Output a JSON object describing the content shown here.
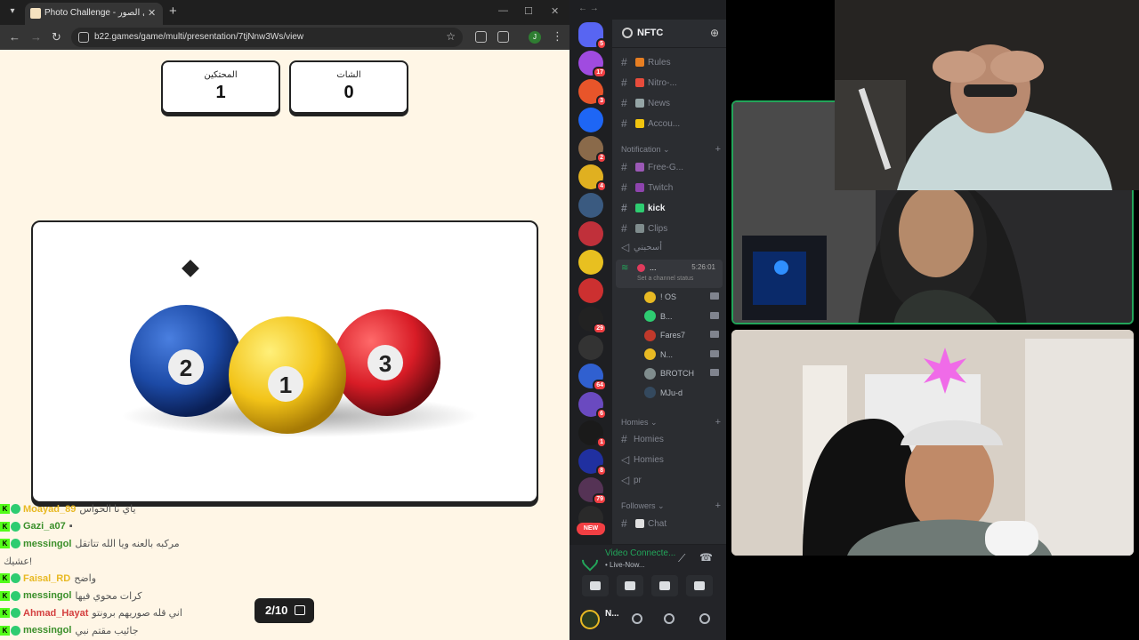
{
  "browser": {
    "tab_title": "Photo Challenge - تحدي الصور",
    "tab_close": "✕",
    "new_tab": "+",
    "url": "b22.games/game/multi/presentation/7tjNnw3Ws/view",
    "profile_initial": "J"
  },
  "scores": [
    {
      "label": "المحتكين",
      "value": "1"
    },
    {
      "label": "الشات",
      "value": "0"
    }
  ],
  "image": {
    "description": "billiard balls",
    "balls": [
      {
        "number": "2",
        "color": "#1c4aa6"
      },
      {
        "number": "1",
        "color": "#f2c318"
      },
      {
        "number": "3",
        "color": "#d81c26"
      }
    ]
  },
  "chat": [
    {
      "user": "Moayad_89",
      "color": "#e8b923",
      "message": "ياي نا الحواس"
    },
    {
      "user": "Gazi_a07",
      "color": "#3a8f2a",
      "message": "▪"
    },
    {
      "user": "messingol",
      "color": "#3a8f2a",
      "message": "مركبه بالعنه ويا الله تتاتقل"
    },
    {
      "user": "",
      "color": "#555555",
      "message": "عشيك!"
    },
    {
      "user": "Faisal_RD",
      "color": "#e8b923",
      "message": "واضح"
    },
    {
      "user": "messingol",
      "color": "#3a8f2a",
      "message": "كرات محوي فيها"
    },
    {
      "user": "Ahmad_Hayat",
      "color": "#d43f3f",
      "message": "اني قله صوريهم برونتو"
    },
    {
      "user": "messingol",
      "color": "#3a8f2a",
      "message": "جائيب مقتم نبي"
    }
  ],
  "slide_counter": "2/10",
  "discord": {
    "server_name": "NFTC",
    "channels": [
      {
        "name": "Rules",
        "icon_color": "#e67e22"
      },
      {
        "name": "Nitro-...",
        "icon_color": "#e74c3c"
      },
      {
        "name": "News",
        "icon_color": "#95a5a6"
      },
      {
        "name": "Accou...",
        "icon_color": "#f1c40f"
      }
    ],
    "category_notification": "Notification",
    "notif_channels": [
      {
        "name": "Free-G...",
        "icon_color": "#9b59b6",
        "bold": false
      },
      {
        "name": "Twitch",
        "icon_color": "#8e44ad",
        "bold": false
      },
      {
        "name": "kick",
        "icon_color": "#2ecc71",
        "bold": true
      },
      {
        "name": "Clips",
        "icon_color": "#7f8c8d",
        "bold": false
      }
    ],
    "voice_label": "أسحبني",
    "active_voice": {
      "name": "...",
      "time": "5:26:01",
      "status": "Set a channel status"
    },
    "voice_users": [
      {
        "name": "! OS",
        "color": "#e8b923"
      },
      {
        "name": "B...",
        "color": "#2ecc71"
      },
      {
        "name": "Fares7",
        "color": "#c0392b"
      },
      {
        "name": "N...",
        "color": "#e8b923"
      },
      {
        "name": "BROTCH",
        "color": "#7f8c8d"
      },
      {
        "name": "MJu-d",
        "color": "#34495e"
      }
    ],
    "category_homies": "Homies",
    "homies_channels": [
      "Homies",
      "Homies",
      "pr"
    ],
    "category_followers": "Followers",
    "followers_channel": "Chat",
    "rtc_title": "Video Connecte...",
    "rtc_sub": "• Live-Now...",
    "user_name": "N...",
    "new_label": "NEW",
    "guild_badges": [
      "5",
      "17",
      "3",
      "2",
      "4",
      "29",
      "64",
      "6",
      "1",
      "8",
      "79",
      "157"
    ]
  }
}
